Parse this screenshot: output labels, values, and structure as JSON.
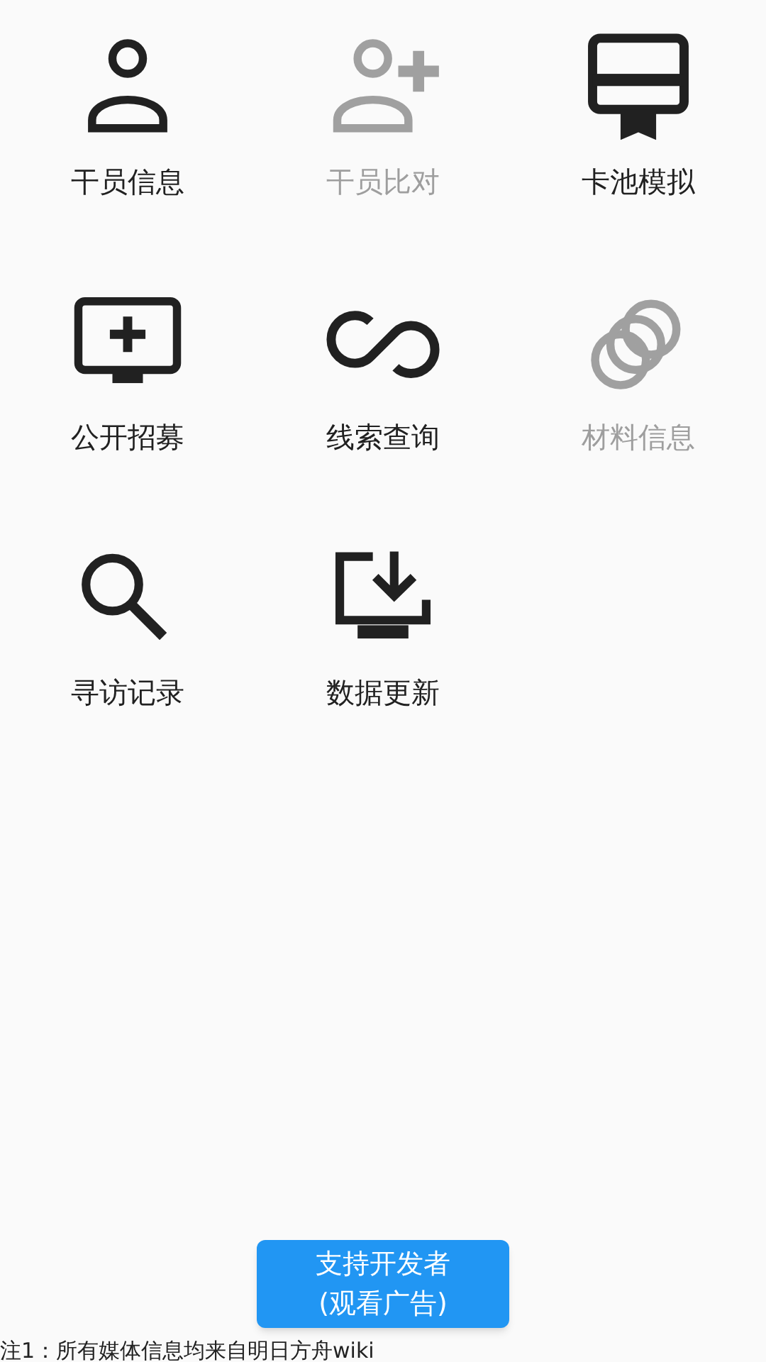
{
  "menu": [
    {
      "kind": "person",
      "label": "干员信息",
      "disabled": false
    },
    {
      "kind": "person-add",
      "label": "干员比对",
      "disabled": true
    },
    {
      "kind": "card",
      "label": "卡池模拟",
      "disabled": false
    },
    {
      "kind": "monitor-plus",
      "label": "公开招募",
      "disabled": false
    },
    {
      "kind": "infinity",
      "label": "线索查询",
      "disabled": false
    },
    {
      "kind": "rings",
      "label": "材料信息",
      "disabled": true
    },
    {
      "kind": "search",
      "label": "寻访记录",
      "disabled": false
    },
    {
      "kind": "monitor-download",
      "label": "数据更新",
      "disabled": false
    }
  ],
  "support_button": {
    "lines": [
      "支持开发者",
      "(观看广告)"
    ]
  },
  "footnote": "注1：所有媒体信息均来自明日方舟wiki"
}
